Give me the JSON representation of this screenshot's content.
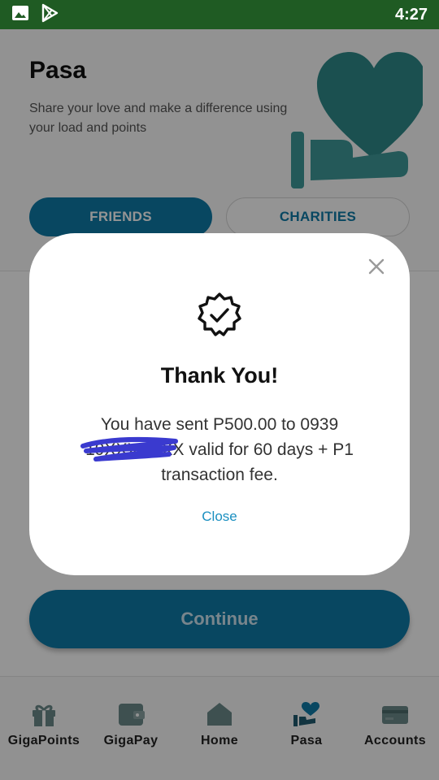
{
  "status_bar": {
    "time": "4:27",
    "icons": [
      "gallery-icon",
      "play-store-icon"
    ]
  },
  "page": {
    "title": "Pasa",
    "subtitle": "Share your love and make a difference using your load and points",
    "hero_icon": "heart-hand-icon",
    "tabs": [
      {
        "label": "FRIENDS",
        "active": true
      },
      {
        "label": "CHARITIES",
        "active": false
      }
    ],
    "continue_label": "Continue"
  },
  "modal": {
    "icon": "verified-badge-icon",
    "title": "Thank You!",
    "message": "You have sent P500.00 to 0939 19XXXXXXX valid for 60 days + P1 transaction fee.",
    "close_label": "Close"
  },
  "nav": {
    "items": [
      {
        "label": "GigaPoints",
        "icon": "gift-icon"
      },
      {
        "label": "GigaPay",
        "icon": "wallet-icon"
      },
      {
        "label": "Home",
        "icon": "home-icon"
      },
      {
        "label": "Pasa",
        "icon": "heart-hand-icon",
        "active": true
      },
      {
        "label": "Accounts",
        "icon": "card-icon"
      }
    ]
  },
  "colors": {
    "accent": "#0f7aa8",
    "status_bar": "#1f5b23",
    "link": "#1a8fc0"
  }
}
